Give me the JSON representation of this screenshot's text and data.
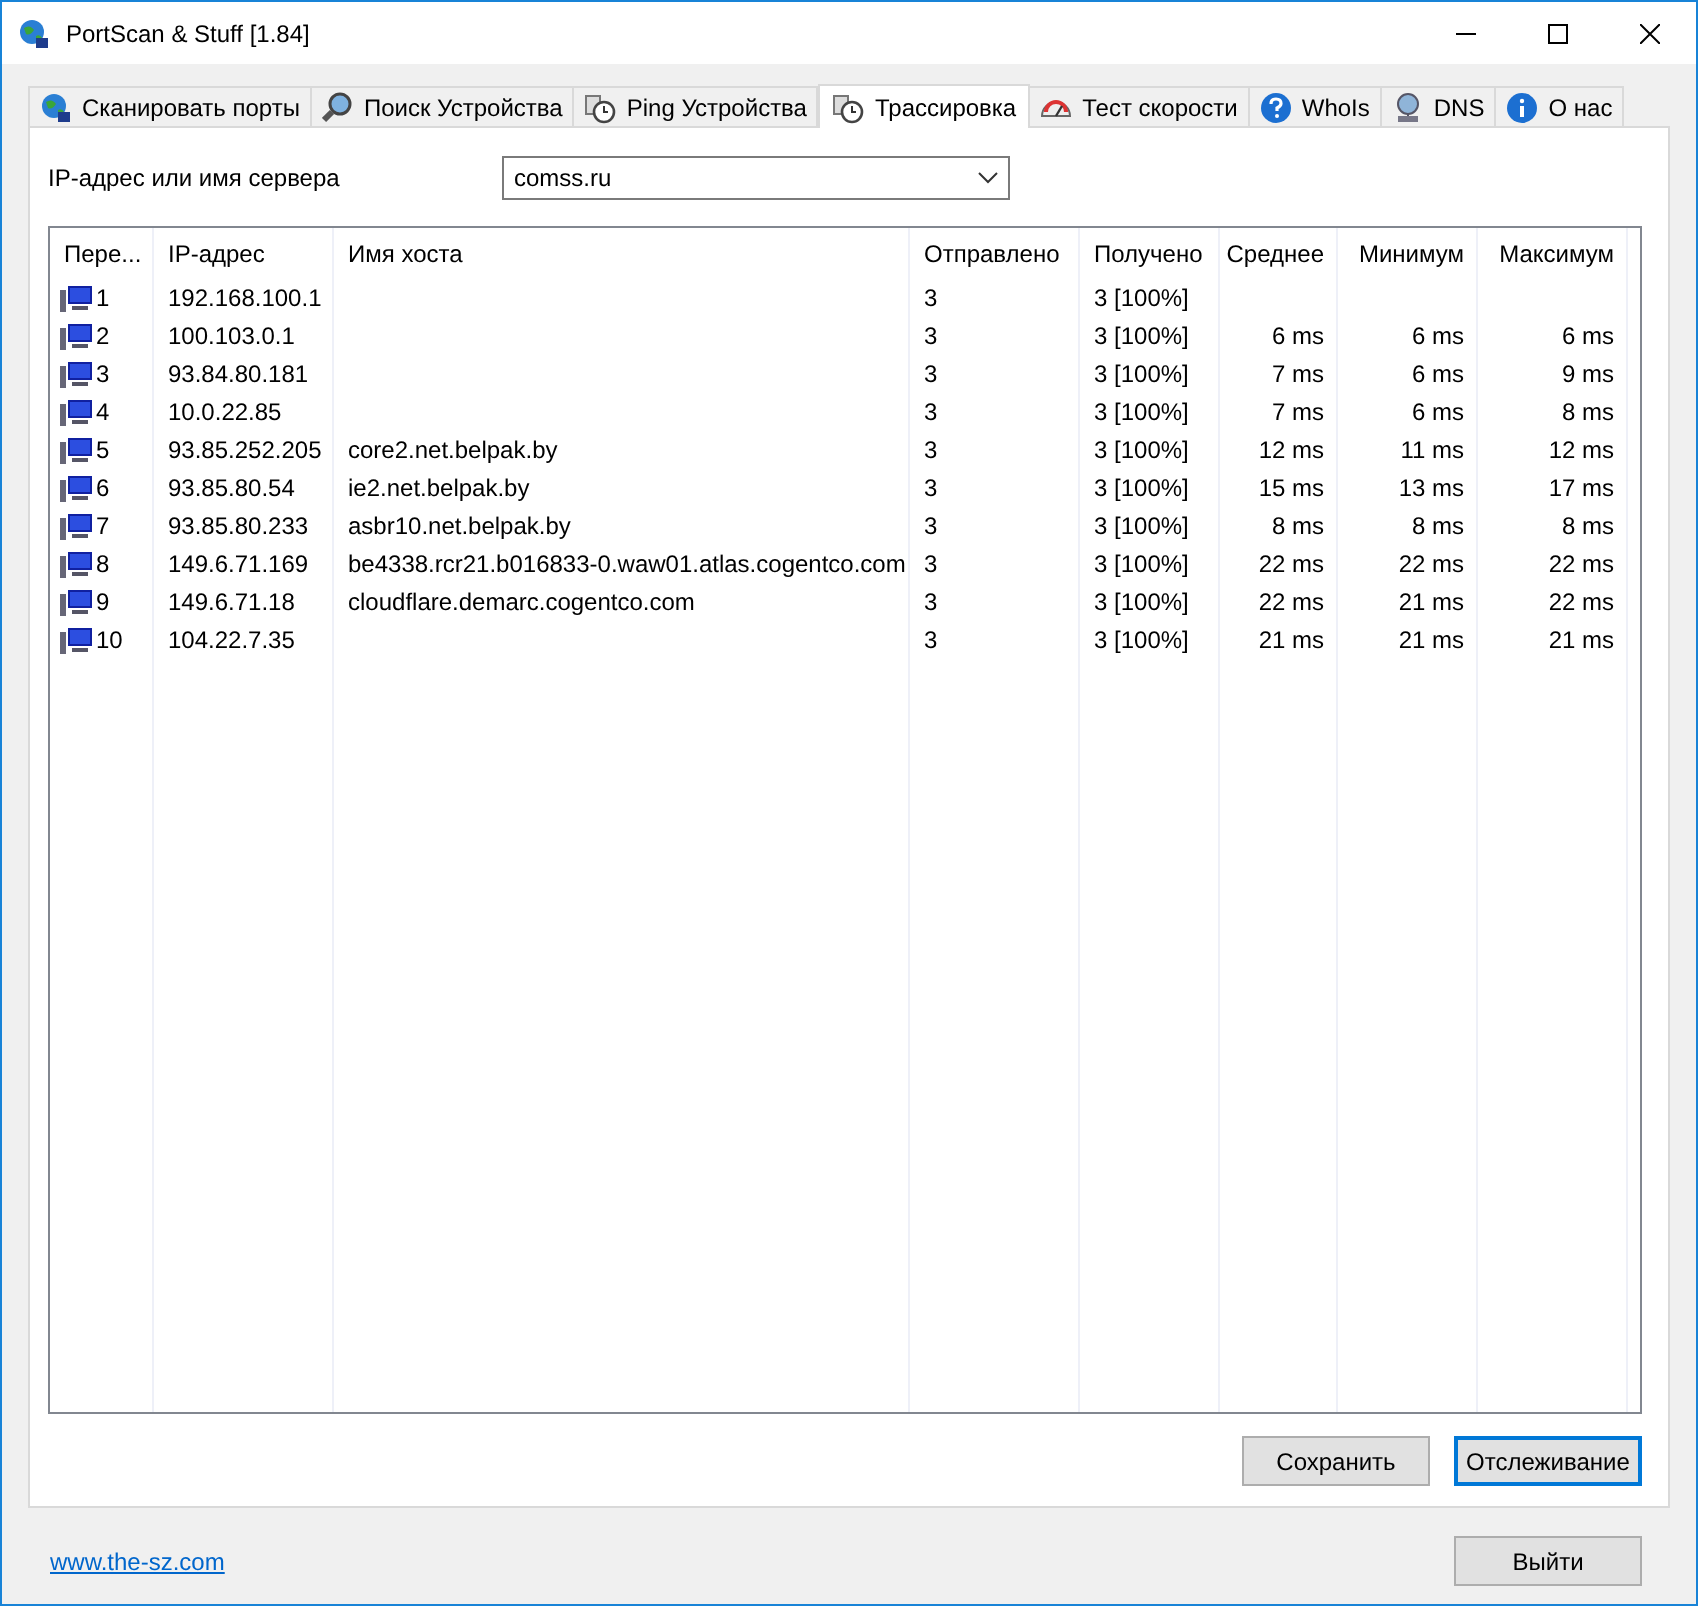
{
  "window": {
    "title": "PortScan & Stuff [1.84]"
  },
  "tabs": [
    {
      "label": "Сканировать порты",
      "selected": false
    },
    {
      "label": "Поиск Устройства",
      "selected": false
    },
    {
      "label": "Ping Устройства",
      "selected": false
    },
    {
      "label": "Трассировка",
      "selected": true
    },
    {
      "label": "Тест скорости",
      "selected": false
    },
    {
      "label": "WhoIs",
      "selected": false
    },
    {
      "label": "DNS",
      "selected": false
    },
    {
      "label": "О нас",
      "selected": false
    }
  ],
  "host_field": {
    "label": "IP-адрес или имя сервера",
    "value": "comss.ru"
  },
  "table": {
    "columns": [
      "Пере...",
      "IP-адрес",
      "Имя хоста",
      "Отправлено",
      "Получено",
      "Среднее",
      "Минимум",
      "Максимум"
    ],
    "rows": [
      [
        "1",
        "192.168.100.1",
        "",
        "3",
        "3 [100%]",
        "",
        "",
        ""
      ],
      [
        "2",
        "100.103.0.1",
        "",
        "3",
        "3 [100%]",
        "6 ms",
        "6 ms",
        "6 ms"
      ],
      [
        "3",
        "93.84.80.181",
        "",
        "3",
        "3 [100%]",
        "7 ms",
        "6 ms",
        "9 ms"
      ],
      [
        "4",
        "10.0.22.85",
        "",
        "3",
        "3 [100%]",
        "7 ms",
        "6 ms",
        "8 ms"
      ],
      [
        "5",
        "93.85.252.205",
        "core2.net.belpak.by",
        "3",
        "3 [100%]",
        "12 ms",
        "11 ms",
        "12 ms"
      ],
      [
        "6",
        "93.85.80.54",
        "ie2.net.belpak.by",
        "3",
        "3 [100%]",
        "15 ms",
        "13 ms",
        "17 ms"
      ],
      [
        "7",
        "93.85.80.233",
        "asbr10.net.belpak.by",
        "3",
        "3 [100%]",
        "8 ms",
        "8 ms",
        "8 ms"
      ],
      [
        "8",
        "149.6.71.169",
        "be4338.rcr21.b016833-0.waw01.atlas.cogentco.com",
        "3",
        "3 [100%]",
        "22 ms",
        "22 ms",
        "22 ms"
      ],
      [
        "9",
        "149.6.71.18",
        "cloudflare.demarc.cogentco.com",
        "3",
        "3 [100%]",
        "22 ms",
        "21 ms",
        "22 ms"
      ],
      [
        "10",
        "104.22.7.35",
        "",
        "3",
        "3 [100%]",
        "21 ms",
        "21 ms",
        "21 ms"
      ]
    ]
  },
  "buttons": [
    {
      "label": "Сохранить",
      "default": false
    },
    {
      "label": "Отслеживание",
      "default": true
    }
  ],
  "footer": {
    "link": "www.the-sz.com",
    "exit_button": "Выйти"
  }
}
